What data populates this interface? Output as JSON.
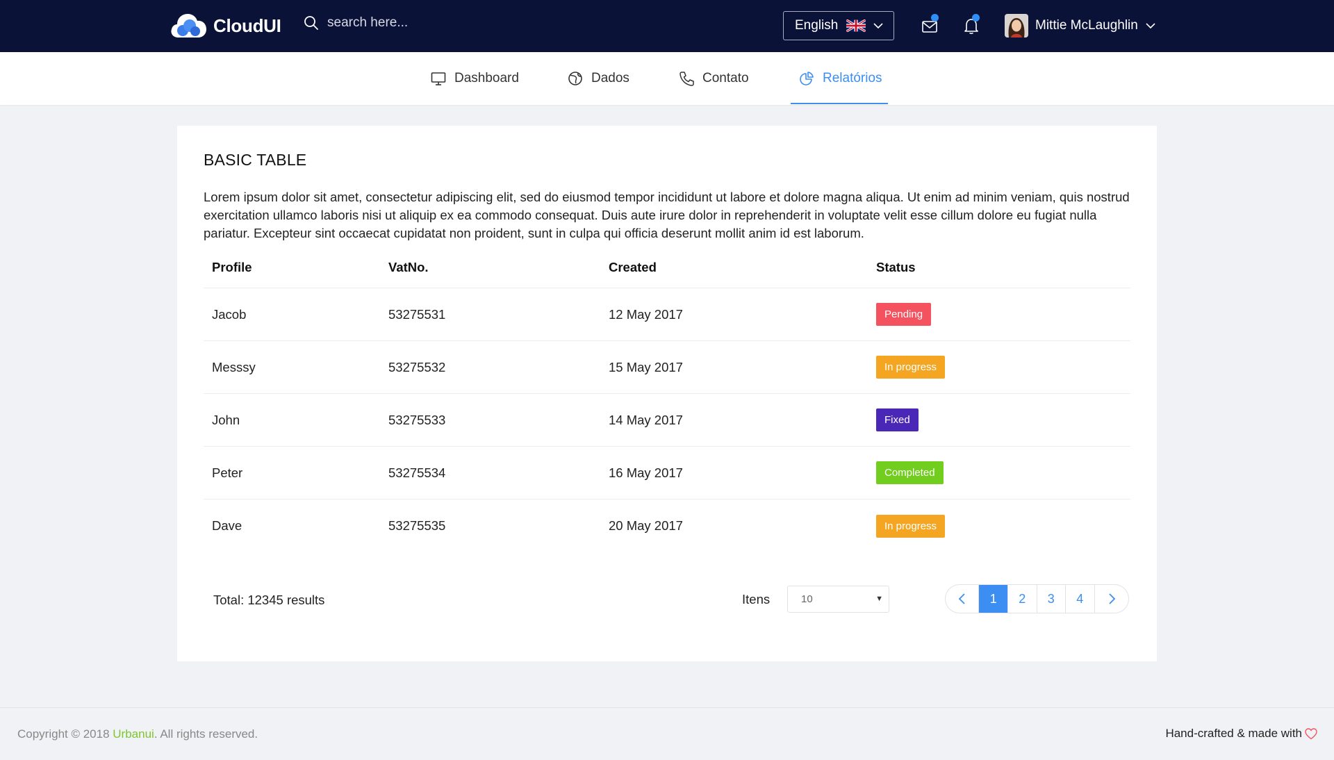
{
  "header": {
    "app_name": "CloudUI",
    "search_placeholder": "search here...",
    "language": "English",
    "user_name": "Mittie McLaughlin"
  },
  "nav": {
    "items": [
      {
        "label": "Dashboard",
        "icon": "monitor-icon"
      },
      {
        "label": "Dados",
        "icon": "globe-icon"
      },
      {
        "label": "Contato",
        "icon": "phone-icon"
      },
      {
        "label": "Relatórios",
        "icon": "pie-chart-icon",
        "active": true
      }
    ]
  },
  "card": {
    "title": "BASIC TABLE",
    "description": "Lorem ipsum dolor sit amet, consectetur adipiscing elit, sed do eiusmod tempor incididunt ut labore et dolore magna aliqua. Ut enim ad minim veniam, quis nostrud exercitation ullamco laboris nisi ut aliquip ex ea commodo consequat. Duis aute irure dolor in reprehenderit in voluptate velit esse cillum dolore eu fugiat nulla pariatur. Excepteur sint occaecat cupidatat non proident, sunt in culpa qui officia deserunt mollit anim id est laborum."
  },
  "table": {
    "columns": [
      "Profile",
      "VatNo.",
      "Created",
      "Status"
    ],
    "rows": [
      {
        "profile": "Jacob",
        "vat": "53275531",
        "created": "12 May 2017",
        "status": "Pending",
        "status_color": "#f4525f"
      },
      {
        "profile": "Messsy",
        "vat": "53275532",
        "created": "15 May 2017",
        "status": "In progress",
        "status_color": "#f4a623"
      },
      {
        "profile": "John",
        "vat": "53275533",
        "created": "14 May 2017",
        "status": "Fixed",
        "status_color": "#4a27b7"
      },
      {
        "profile": "Peter",
        "vat": "53275534",
        "created": "16 May 2017",
        "status": "Completed",
        "status_color": "#71cd1e"
      },
      {
        "profile": "Dave",
        "vat": "53275535",
        "created": "20 May 2017",
        "status": "In progress",
        "status_color": "#f4a623"
      }
    ]
  },
  "pagination": {
    "total": "Total: 12345 results",
    "items_label": "Itens",
    "items_value": "10",
    "pages": [
      "1",
      "2",
      "3",
      "4"
    ],
    "current_page": "1"
  },
  "footer": {
    "copyright_prefix": "Copyright © 2018 ",
    "brand": "Urbanui",
    "copyright_suffix": ". All rights reserved.",
    "handcrafted": "Hand-crafted & made with"
  },
  "colors": {
    "topbar": "#0b1238",
    "accent": "#3c8ef3",
    "brand_green": "#7cc62e"
  }
}
